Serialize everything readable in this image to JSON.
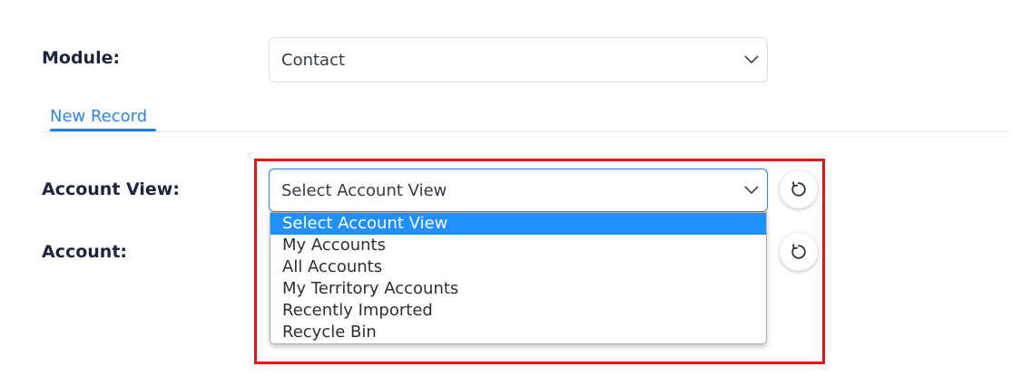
{
  "module": {
    "label": "Module:",
    "value": "Contact"
  },
  "tabs": [
    {
      "label": "New Record",
      "active": true
    }
  ],
  "account_view": {
    "label": "Account View:",
    "value": "Select Account View",
    "options": [
      {
        "label": "Select Account View",
        "selected": true
      },
      {
        "label": "My Accounts",
        "selected": false
      },
      {
        "label": "All Accounts",
        "selected": false
      },
      {
        "label": "My Territory Accounts",
        "selected": false
      },
      {
        "label": "Recently Imported",
        "selected": false
      },
      {
        "label": "Recycle Bin",
        "selected": false
      }
    ],
    "refresh_icon": "refresh-icon"
  },
  "account": {
    "label": "Account:",
    "refresh_icon": "refresh-icon"
  },
  "colors": {
    "accent": "#1e90ff",
    "tab_text": "#2f86e6",
    "highlight": "#ee1111"
  }
}
